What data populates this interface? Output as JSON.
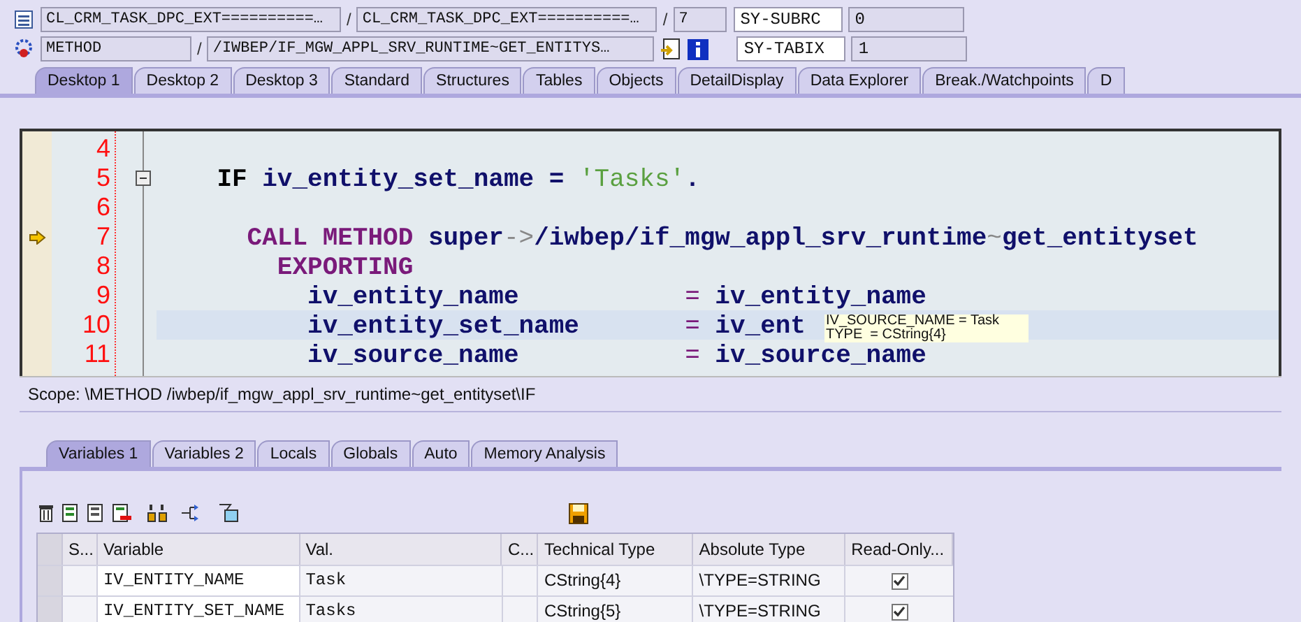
{
  "header": {
    "row1": {
      "fields": [
        {
          "text": "CL_CRM_TASK_DPC_EXT==========…",
          "kind": "gray"
        },
        {
          "text": "/",
          "kind": "sep"
        },
        {
          "text": "CL_CRM_TASK_DPC_EXT==========…",
          "kind": "gray"
        },
        {
          "text": "/",
          "kind": "sep"
        },
        {
          "text": "7",
          "kind": "gray"
        }
      ],
      "sys_name": "SY-SUBRC",
      "sys_value": "0"
    },
    "row2": {
      "fields": [
        {
          "text": "METHOD",
          "kind": "gray"
        },
        {
          "text": "/",
          "kind": "sep"
        },
        {
          "text": "/IWBEP/IF_MGW_APPL_SRV_RUNTIME~GET_ENTITYS…",
          "kind": "gray"
        }
      ],
      "sys_name": "SY-TABIX",
      "sys_value": "1"
    }
  },
  "tabs": [
    {
      "label": "Desktop 1",
      "selected": true
    },
    {
      "label": "Desktop 2",
      "selected": false
    },
    {
      "label": "Desktop 3",
      "selected": false
    },
    {
      "label": "Standard",
      "selected": false
    },
    {
      "label": "Structures",
      "selected": false
    },
    {
      "label": "Tables",
      "selected": false
    },
    {
      "label": "Objects",
      "selected": false
    },
    {
      "label": "DetailDisplay",
      "selected": false
    },
    {
      "label": "Data Explorer",
      "selected": false
    },
    {
      "label": "Break./Watchpoints",
      "selected": false
    },
    {
      "label": "D",
      "selected": false
    }
  ],
  "code": [
    {
      "number": "4",
      "current": false,
      "highlighted": false,
      "fold": false
    },
    {
      "number": "5",
      "current": false,
      "highlighted": false,
      "fold": true,
      "tokens": [
        {
          "kind": "ctl",
          "text": "    IF "
        },
        {
          "kind": "id",
          "text": "iv_entity_set_name = "
        },
        {
          "kind": "str",
          "text": "'Tasks'"
        },
        {
          "kind": "id",
          "text": "."
        }
      ]
    },
    {
      "number": "6",
      "current": false,
      "highlighted": false,
      "fold": false
    },
    {
      "number": "7",
      "current": true,
      "highlighted": false,
      "fold": false,
      "tokens": [
        {
          "kind": "kw",
          "text": "      CALL METHOD "
        },
        {
          "kind": "id",
          "text": "super"
        },
        {
          "kind": "op",
          "text": "->"
        },
        {
          "kind": "id",
          "text": "/iwbep/if_mgw_appl_srv_runtime"
        },
        {
          "kind": "op",
          "text": "~"
        },
        {
          "kind": "id",
          "text": "get_entityset"
        }
      ]
    },
    {
      "number": "8",
      "current": false,
      "highlighted": false,
      "fold": false,
      "tokens": [
        {
          "kind": "kw",
          "text": "        EXPORTING"
        }
      ]
    },
    {
      "number": "9",
      "current": false,
      "highlighted": false,
      "fold": false,
      "tokens": [
        {
          "kind": "id",
          "text": "          iv_entity_name           "
        },
        {
          "kind": "eq",
          "text": "= "
        },
        {
          "kind": "id",
          "text": "iv_entity_name"
        }
      ]
    },
    {
      "number": "10",
      "current": false,
      "highlighted": true,
      "fold": false,
      "tokens": [
        {
          "kind": "id",
          "text": "          iv_entity_set_name       "
        },
        {
          "kind": "eq",
          "text": "= "
        },
        {
          "kind": "id",
          "text": "iv_ent"
        }
      ]
    },
    {
      "number": "11",
      "current": false,
      "highlighted": false,
      "fold": false,
      "tokens": [
        {
          "kind": "id",
          "text": "          iv_source_name           "
        },
        {
          "kind": "eq",
          "text": "= "
        },
        {
          "kind": "id",
          "text": "iv_source_name"
        }
      ]
    }
  ],
  "tooltip": {
    "lines": [
      "IV_SOURCE_NAME = Task",
      "TYPE  = CString{4}"
    ]
  },
  "scope": "Scope: \\METHOD /iwbep/if_mgw_appl_srv_runtime~get_entityset\\IF",
  "lower_tabs": [
    {
      "label": "Variables 1",
      "selected": true
    },
    {
      "label": "Variables 2",
      "selected": false
    },
    {
      "label": "Locals",
      "selected": false
    },
    {
      "label": "Globals",
      "selected": false
    },
    {
      "label": "Auto",
      "selected": false
    },
    {
      "label": "Memory Analysis",
      "selected": false
    }
  ],
  "table": {
    "columns": [
      "S...",
      "Variable",
      "Val.",
      "C...",
      "Technical Type",
      "Absolute Type",
      "Read-Only..."
    ],
    "rows": [
      {
        "variable": "IV_ENTITY_NAME",
        "value": "Task",
        "technical_type": "CString{4}",
        "absolute_type": "\\TYPE=STRING",
        "read_only": true
      },
      {
        "variable": "IV_ENTITY_SET_NAME",
        "value": "Tasks",
        "technical_type": "CString{5}",
        "absolute_type": "\\TYPE=STRING",
        "read_only": true
      }
    ]
  }
}
